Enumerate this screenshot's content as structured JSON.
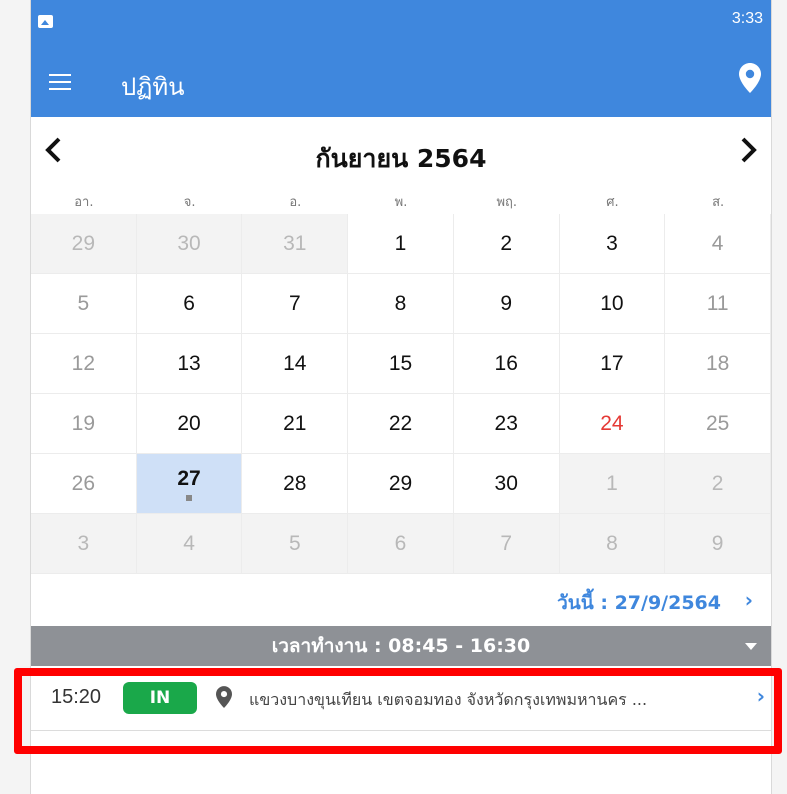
{
  "status_bar": {
    "time": "3:33"
  },
  "app_bar": {
    "title": "ปฏิทิน",
    "menu_icon": "hamburger-icon",
    "location_icon": "map-pin-icon"
  },
  "calendar": {
    "month_title": "กันยายน 2564",
    "weekdays": [
      "อา.",
      "จ.",
      "อ.",
      "พ.",
      "พฤ.",
      "ศ.",
      "ส."
    ],
    "days": [
      {
        "label": "29",
        "kind": "other"
      },
      {
        "label": "30",
        "kind": "other"
      },
      {
        "label": "31",
        "kind": "other"
      },
      {
        "label": "1",
        "kind": "normal"
      },
      {
        "label": "2",
        "kind": "normal"
      },
      {
        "label": "3",
        "kind": "normal"
      },
      {
        "label": "4",
        "kind": "weekend"
      },
      {
        "label": "5",
        "kind": "weekend"
      },
      {
        "label": "6",
        "kind": "normal"
      },
      {
        "label": "7",
        "kind": "normal"
      },
      {
        "label": "8",
        "kind": "normal"
      },
      {
        "label": "9",
        "kind": "normal"
      },
      {
        "label": "10",
        "kind": "normal"
      },
      {
        "label": "11",
        "kind": "weekend"
      },
      {
        "label": "12",
        "kind": "weekend"
      },
      {
        "label": "13",
        "kind": "normal"
      },
      {
        "label": "14",
        "kind": "normal"
      },
      {
        "label": "15",
        "kind": "normal"
      },
      {
        "label": "16",
        "kind": "normal"
      },
      {
        "label": "17",
        "kind": "normal"
      },
      {
        "label": "18",
        "kind": "weekend"
      },
      {
        "label": "19",
        "kind": "weekend"
      },
      {
        "label": "20",
        "kind": "normal"
      },
      {
        "label": "21",
        "kind": "normal"
      },
      {
        "label": "22",
        "kind": "normal"
      },
      {
        "label": "23",
        "kind": "normal"
      },
      {
        "label": "24",
        "kind": "holiday"
      },
      {
        "label": "25",
        "kind": "weekend"
      },
      {
        "label": "26",
        "kind": "weekend"
      },
      {
        "label": "27",
        "kind": "today"
      },
      {
        "label": "28",
        "kind": "normal"
      },
      {
        "label": "29",
        "kind": "normal"
      },
      {
        "label": "30",
        "kind": "normal"
      },
      {
        "label": "1",
        "kind": "other"
      },
      {
        "label": "2",
        "kind": "other"
      },
      {
        "label": "3",
        "kind": "other"
      },
      {
        "label": "4",
        "kind": "other"
      },
      {
        "label": "5",
        "kind": "other"
      },
      {
        "label": "6",
        "kind": "other"
      },
      {
        "label": "7",
        "kind": "other"
      },
      {
        "label": "8",
        "kind": "other"
      },
      {
        "label": "9",
        "kind": "other"
      }
    ]
  },
  "today_link": "วันนี้ : 27/9/2564",
  "work_hours": "เวลาทำงาน : 08:45 - 16:30",
  "record": {
    "time": "15:20",
    "type": "IN",
    "address": "แขวงบางขุนเทียน เขตจอมทอง จังหวัดกรุงเทพมหานคร ..."
  },
  "colors": {
    "primary": "#3f87dd",
    "in_badge": "#1aa84a",
    "holiday": "#e53935",
    "highlight": "#ff0000"
  }
}
